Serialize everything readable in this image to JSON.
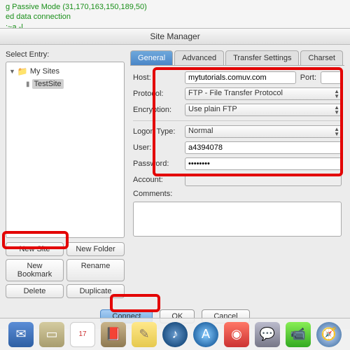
{
  "bg_terminal": {
    "line1": "g Passive Mode (31,170,163,150,189,50)",
    "line2": "ed data connection",
    "line3": ":~a -l"
  },
  "dialog": {
    "title": "Site Manager",
    "select_entry_label": "Select Entry:",
    "tree": {
      "root": "My Sites",
      "item": "TestSite"
    },
    "buttons": {
      "new_site": "New Site",
      "new_folder": "New Folder",
      "new_bookmark": "New Bookmark",
      "rename": "Rename",
      "delete": "Delete",
      "duplicate": "Duplicate"
    },
    "tabs": {
      "general": "General",
      "advanced": "Advanced",
      "transfer": "Transfer Settings",
      "charset": "Charset"
    },
    "form": {
      "host_label": "Host:",
      "host_value": "mytutorials.comuv.com",
      "port_label": "Port:",
      "protocol_label": "Protocol:",
      "protocol_value": "FTP - File Transfer Protocol",
      "encryption_label": "Encryption:",
      "encryption_value": "Use plain FTP",
      "logon_label": "Logon Type:",
      "logon_value": "Normal",
      "user_label": "User:",
      "user_value": "a4394078",
      "password_label": "Password:",
      "password_value": "••••••••",
      "account_label": "Account:",
      "comments_label": "Comments:"
    },
    "bottom": {
      "connect": "Connect",
      "ok": "OK",
      "cancel": "Cancel"
    }
  }
}
